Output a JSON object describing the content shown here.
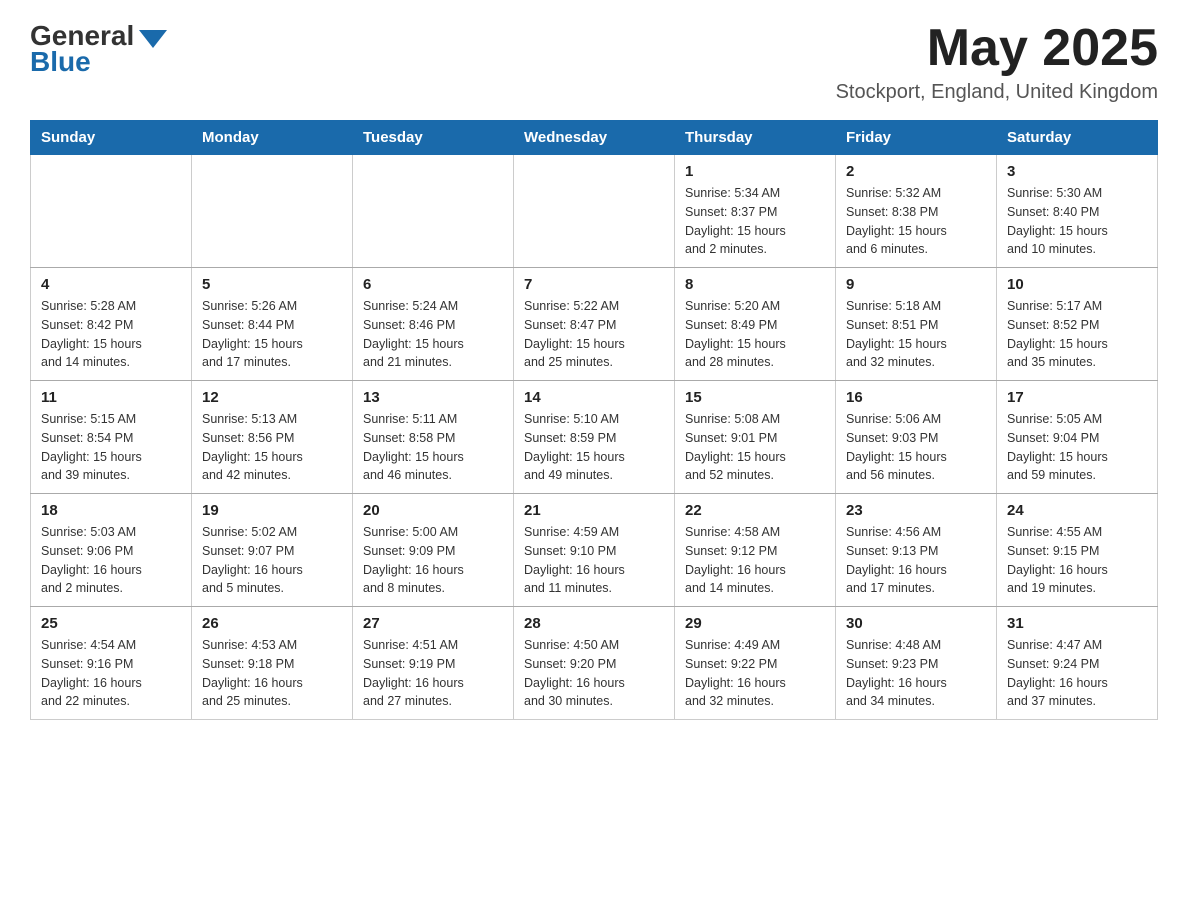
{
  "header": {
    "logo_general": "General",
    "logo_blue": "Blue",
    "month_title": "May 2025",
    "location": "Stockport, England, United Kingdom"
  },
  "weekdays": [
    "Sunday",
    "Monday",
    "Tuesday",
    "Wednesday",
    "Thursday",
    "Friday",
    "Saturday"
  ],
  "weeks": [
    [
      {
        "day": "",
        "info": ""
      },
      {
        "day": "",
        "info": ""
      },
      {
        "day": "",
        "info": ""
      },
      {
        "day": "",
        "info": ""
      },
      {
        "day": "1",
        "info": "Sunrise: 5:34 AM\nSunset: 8:37 PM\nDaylight: 15 hours\nand 2 minutes."
      },
      {
        "day": "2",
        "info": "Sunrise: 5:32 AM\nSunset: 8:38 PM\nDaylight: 15 hours\nand 6 minutes."
      },
      {
        "day": "3",
        "info": "Sunrise: 5:30 AM\nSunset: 8:40 PM\nDaylight: 15 hours\nand 10 minutes."
      }
    ],
    [
      {
        "day": "4",
        "info": "Sunrise: 5:28 AM\nSunset: 8:42 PM\nDaylight: 15 hours\nand 14 minutes."
      },
      {
        "day": "5",
        "info": "Sunrise: 5:26 AM\nSunset: 8:44 PM\nDaylight: 15 hours\nand 17 minutes."
      },
      {
        "day": "6",
        "info": "Sunrise: 5:24 AM\nSunset: 8:46 PM\nDaylight: 15 hours\nand 21 minutes."
      },
      {
        "day": "7",
        "info": "Sunrise: 5:22 AM\nSunset: 8:47 PM\nDaylight: 15 hours\nand 25 minutes."
      },
      {
        "day": "8",
        "info": "Sunrise: 5:20 AM\nSunset: 8:49 PM\nDaylight: 15 hours\nand 28 minutes."
      },
      {
        "day": "9",
        "info": "Sunrise: 5:18 AM\nSunset: 8:51 PM\nDaylight: 15 hours\nand 32 minutes."
      },
      {
        "day": "10",
        "info": "Sunrise: 5:17 AM\nSunset: 8:52 PM\nDaylight: 15 hours\nand 35 minutes."
      }
    ],
    [
      {
        "day": "11",
        "info": "Sunrise: 5:15 AM\nSunset: 8:54 PM\nDaylight: 15 hours\nand 39 minutes."
      },
      {
        "day": "12",
        "info": "Sunrise: 5:13 AM\nSunset: 8:56 PM\nDaylight: 15 hours\nand 42 minutes."
      },
      {
        "day": "13",
        "info": "Sunrise: 5:11 AM\nSunset: 8:58 PM\nDaylight: 15 hours\nand 46 minutes."
      },
      {
        "day": "14",
        "info": "Sunrise: 5:10 AM\nSunset: 8:59 PM\nDaylight: 15 hours\nand 49 minutes."
      },
      {
        "day": "15",
        "info": "Sunrise: 5:08 AM\nSunset: 9:01 PM\nDaylight: 15 hours\nand 52 minutes."
      },
      {
        "day": "16",
        "info": "Sunrise: 5:06 AM\nSunset: 9:03 PM\nDaylight: 15 hours\nand 56 minutes."
      },
      {
        "day": "17",
        "info": "Sunrise: 5:05 AM\nSunset: 9:04 PM\nDaylight: 15 hours\nand 59 minutes."
      }
    ],
    [
      {
        "day": "18",
        "info": "Sunrise: 5:03 AM\nSunset: 9:06 PM\nDaylight: 16 hours\nand 2 minutes."
      },
      {
        "day": "19",
        "info": "Sunrise: 5:02 AM\nSunset: 9:07 PM\nDaylight: 16 hours\nand 5 minutes."
      },
      {
        "day": "20",
        "info": "Sunrise: 5:00 AM\nSunset: 9:09 PM\nDaylight: 16 hours\nand 8 minutes."
      },
      {
        "day": "21",
        "info": "Sunrise: 4:59 AM\nSunset: 9:10 PM\nDaylight: 16 hours\nand 11 minutes."
      },
      {
        "day": "22",
        "info": "Sunrise: 4:58 AM\nSunset: 9:12 PM\nDaylight: 16 hours\nand 14 minutes."
      },
      {
        "day": "23",
        "info": "Sunrise: 4:56 AM\nSunset: 9:13 PM\nDaylight: 16 hours\nand 17 minutes."
      },
      {
        "day": "24",
        "info": "Sunrise: 4:55 AM\nSunset: 9:15 PM\nDaylight: 16 hours\nand 19 minutes."
      }
    ],
    [
      {
        "day": "25",
        "info": "Sunrise: 4:54 AM\nSunset: 9:16 PM\nDaylight: 16 hours\nand 22 minutes."
      },
      {
        "day": "26",
        "info": "Sunrise: 4:53 AM\nSunset: 9:18 PM\nDaylight: 16 hours\nand 25 minutes."
      },
      {
        "day": "27",
        "info": "Sunrise: 4:51 AM\nSunset: 9:19 PM\nDaylight: 16 hours\nand 27 minutes."
      },
      {
        "day": "28",
        "info": "Sunrise: 4:50 AM\nSunset: 9:20 PM\nDaylight: 16 hours\nand 30 minutes."
      },
      {
        "day": "29",
        "info": "Sunrise: 4:49 AM\nSunset: 9:22 PM\nDaylight: 16 hours\nand 32 minutes."
      },
      {
        "day": "30",
        "info": "Sunrise: 4:48 AM\nSunset: 9:23 PM\nDaylight: 16 hours\nand 34 minutes."
      },
      {
        "day": "31",
        "info": "Sunrise: 4:47 AM\nSunset: 9:24 PM\nDaylight: 16 hours\nand 37 minutes."
      }
    ]
  ]
}
